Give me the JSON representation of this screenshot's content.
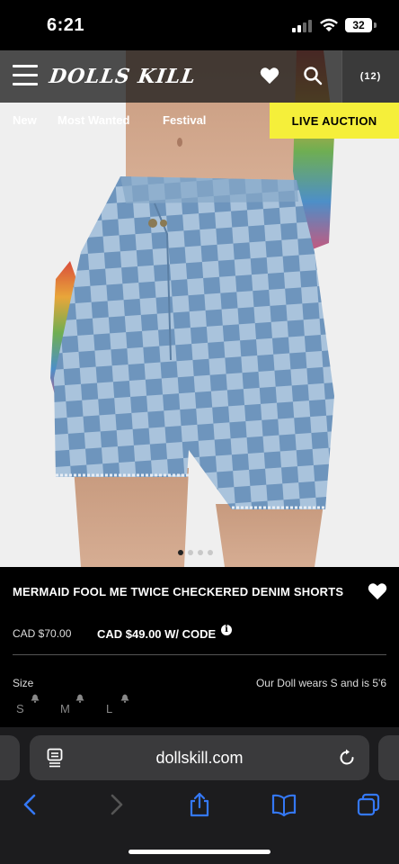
{
  "status_bar": {
    "time": "6:21",
    "battery": "32"
  },
  "header": {
    "logo": "DOLLS KILL",
    "cart_count": "(12)"
  },
  "nav": {
    "items": [
      "New",
      "Most Wanted",
      "Festival"
    ],
    "live_auction": "LIVE AUCTION"
  },
  "carousel": {
    "dot_count": 4,
    "active_index": 0
  },
  "product": {
    "title": "MERMAID FOOL ME TWICE CHECKERED DENIM SHORTS",
    "price_original": "CAD $70.00",
    "price_code": "CAD $49.00 W/ CODE",
    "size_label": "Size",
    "size_note": "Our Doll wears S and is 5'6",
    "sizes": [
      "S",
      "M",
      "L"
    ]
  },
  "browser": {
    "url": "dollskill.com"
  },
  "colors": {
    "accent": "#f5ef3a",
    "background": "#000000",
    "toolbar": "#1c1c1e",
    "link_blue": "#3478f6"
  },
  "icons": [
    "hamburger-icon",
    "heart-icon",
    "search-icon",
    "info-icon",
    "bell-icon",
    "page-icon",
    "reload-icon",
    "back-icon",
    "forward-icon",
    "share-icon",
    "bookmarks-icon",
    "tabs-icon"
  ]
}
